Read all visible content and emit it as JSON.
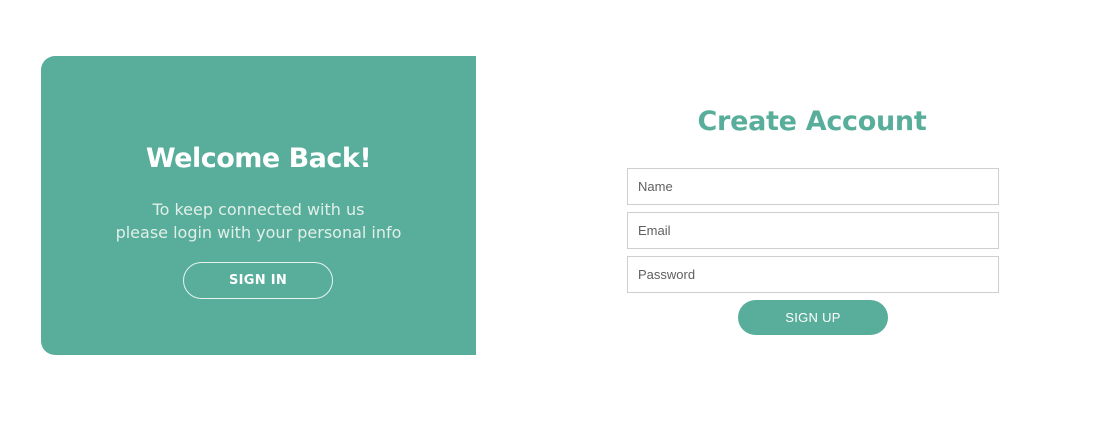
{
  "colors": {
    "accent": "#58ae9b",
    "background": "#ffffff",
    "field_border": "#cfcfcf"
  },
  "left_panel": {
    "title": "Welcome Back!",
    "text_line_1": "To keep connected with us",
    "text_line_2": "please login with your personal info",
    "sign_in_label": "SIGN IN"
  },
  "signup_form": {
    "title": "Create Account",
    "name_placeholder": "Name",
    "email_placeholder": "Email",
    "password_placeholder": "Password",
    "sign_up_label": "SIGN UP"
  }
}
